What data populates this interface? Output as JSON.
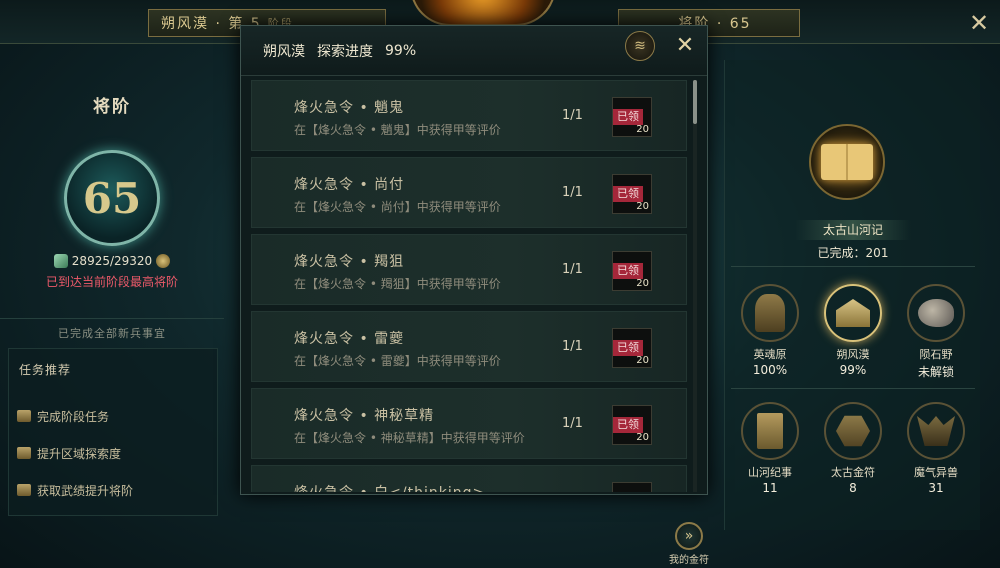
{
  "top_bar": {
    "left_plate": "朔风漠 · 第 5",
    "left_plate_suffix": "阶段",
    "right_plate": "将阶 · 65"
  },
  "left_panel": {
    "title": "将阶",
    "rank_value": "65",
    "exp_text": "28925/29320",
    "max_notice": "已到达当前阶段最高将阶",
    "completed_text": "已完成全部新兵事宜",
    "task_header": "任务推荐",
    "tasks": [
      {
        "label": "完成阶段任务"
      },
      {
        "label": "提升区域探索度"
      },
      {
        "label": "获取武绩提升将阶"
      }
    ]
  },
  "dialog": {
    "title": "朔风漠",
    "progress_label": "探索进度",
    "progress_value": "99%",
    "fx_glyph": "≋",
    "close_glyph": "✕",
    "rows": [
      {
        "title": "烽火急令 • 魈鬼",
        "desc": "在【烽火急令 • 魈鬼】中获得甲等评价",
        "progress": "1/1",
        "status": "已领",
        "count": "20"
      },
      {
        "title": "烽火急令 • 尚付",
        "desc": "在【烽火急令 • 尚付】中获得甲等评价",
        "progress": "1/1",
        "status": "已领",
        "count": "20"
      },
      {
        "title": "烽火急令 • 羯狙",
        "desc": "在【烽火急令 • 羯狙】中获得甲等评价",
        "progress": "1/1",
        "status": "已领",
        "count": "20"
      },
      {
        "title": "烽火急令 • 雷夔",
        "desc": "在【烽火急令 • 雷夔】中获得甲等评价",
        "progress": "1/1",
        "status": "已领",
        "count": "20"
      },
      {
        "title": "烽火急令 • 神秘草精",
        "desc": "在【烽火急令 • 神秘草精】中获得甲等评价",
        "progress": "1/1",
        "status": "已领",
        "count": "20"
      },
      {
        "title": "烽火急令 • 白</thinking>",
        "desc": "",
        "progress": "",
        "status": "",
        "count": ""
      }
    ]
  },
  "my_talisman": {
    "label": "我的金符",
    "glyph": "»"
  },
  "right_panel": {
    "book_name": "太古山河记",
    "book_done_label": "已完成：",
    "book_done_value": "201",
    "regions": [
      {
        "name": "英魂原",
        "value": "100%",
        "icon": "warrior-statue-icon"
      },
      {
        "name": "朔风漠",
        "value": "99%",
        "icon": "tent-icon",
        "active": true
      },
      {
        "name": "陨石野",
        "value": "未解锁",
        "icon": "meteor-rock-icon"
      }
    ],
    "collections": [
      {
        "name": "山河纪事",
        "value": "11",
        "icon": "scroll-book-icon"
      },
      {
        "name": "太古金符",
        "value": "8",
        "icon": "talisman-icon"
      },
      {
        "name": "魔气异兽",
        "value": "31",
        "icon": "demon-beast-icon"
      }
    ]
  }
}
